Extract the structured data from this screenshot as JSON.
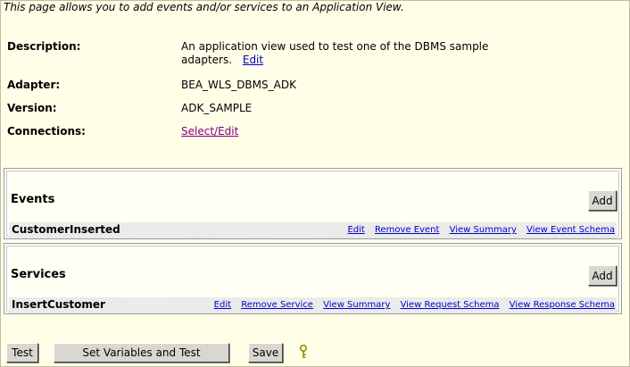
{
  "intro": "This page allows you to add events and/or services to an Application View.",
  "details": {
    "description_label": "Description:",
    "description_line1": "An application view used to test one of the DBMS sample",
    "description_line2": "adapters.",
    "description_edit": "Edit",
    "adapter_label": "Adapter:",
    "adapter_value": "BEA_WLS_DBMS_ADK",
    "version_label": "Version:",
    "version_value": "ADK_SAMPLE",
    "connections_label": "Connections:",
    "connections_link": "Select/Edit"
  },
  "events": {
    "title": "Events",
    "add_label": "Add",
    "item_name": "CustomerInserted",
    "links": [
      "Edit",
      "Remove Event",
      "View Summary",
      "View Event Schema"
    ]
  },
  "services": {
    "title": "Services",
    "add_label": "Add",
    "item_name": "InsertCustomer",
    "links": [
      "Edit",
      "Remove Service",
      "View Summary",
      "View Request Schema",
      "View Response Schema"
    ]
  },
  "footer": {
    "test_label": "Test",
    "set_vars_label": "Set Variables and Test",
    "save_label": "Save",
    "help_icon": "help-key-icon"
  }
}
